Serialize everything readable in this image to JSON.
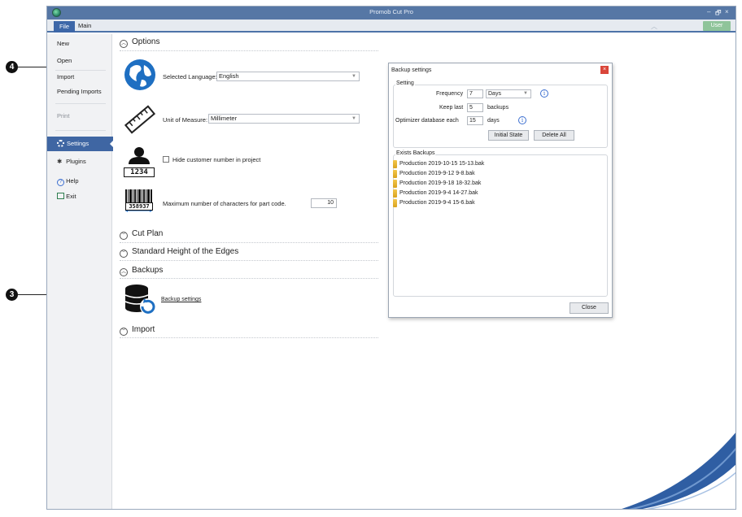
{
  "window": {
    "title": "Promob Cut Pro",
    "controls": [
      "–",
      "🗗",
      "×"
    ]
  },
  "ribbon": {
    "tabs": [
      {
        "label": "File"
      },
      {
        "label": "Main"
      }
    ],
    "user_button": "User",
    "collapse_icon": "chevron-up-icon"
  },
  "menu": {
    "items": [
      "New",
      "Open",
      "Import",
      "Pending Imports",
      "Print"
    ],
    "settings": "Settings",
    "plugins": "Plugins",
    "help": "Help",
    "exit": "Exit"
  },
  "options": {
    "header": "Options",
    "language_label": "Selected Language:",
    "language_value": "English",
    "unit_label": "Unit of Measure:",
    "unit_value": "Millimeter",
    "hide_customer_label": "Hide customer number in project",
    "customer_badge": "1234",
    "barcode_number": "358937",
    "max_chars_label": "Maximum number of characters for part code.",
    "max_chars_value": "10"
  },
  "sections": {
    "cut_plan": "Cut Plan",
    "std_height": "Standard Height of the Edges",
    "backups": "Backups",
    "backup_settings_link": "Backup settings",
    "import": "Import"
  },
  "dialog": {
    "title": "Backup settings",
    "setting_group": "Setting",
    "frequency_label": "Frequency",
    "frequency_value": "7",
    "frequency_unit": "Days",
    "keep_last_label": "Keep last",
    "keep_last_value": "5",
    "keep_last_unit": "backups",
    "optimizer_label": "Optimizer database each",
    "optimizer_value": "15",
    "optimizer_unit": "days",
    "initial_state_button": "Initial State",
    "delete_all_button": "Delete All",
    "exists_group": "Exists Backups",
    "backups": [
      "Production 2019-10-15 15-13.bak",
      "Production 2019-9-12 9-8.bak",
      "Production 2019-9-18 18-32.bak",
      "Production 2019-9-4 14-27.bak",
      "Production 2019-9-4 15-6.bak"
    ],
    "close_button": "Close",
    "info_glyph": "i"
  },
  "callouts": {
    "three": "3",
    "four": "4"
  },
  "colors": {
    "titlebar": "#5677a5",
    "accent": "#3f66a3",
    "user_button": "#8fc49a",
    "close_red": "#d9463a"
  }
}
